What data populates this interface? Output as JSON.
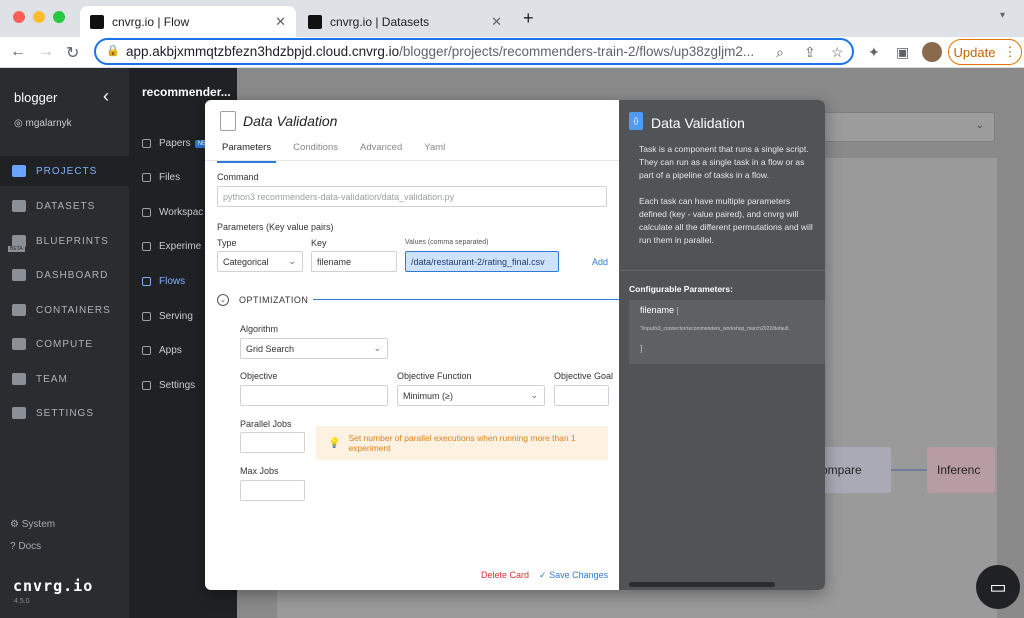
{
  "browser": {
    "tabs": [
      {
        "title": "cnvrg.io | Flow",
        "close": "✕"
      },
      {
        "title": "cnvrg.io | Datasets",
        "close": "✕"
      }
    ],
    "new_tab": "+",
    "url_host": "app.akbjxmmqtzbfezn3hdzbpjd.cloud.cnvrg.io",
    "url_path": "/blogger/projects/recommenders-train-2/flows/up38zgljm2...",
    "update_label": "Update",
    "menu": "⋮"
  },
  "sidebar": {
    "org": "blogger",
    "user": "mgalarnyk",
    "items": [
      "PROJECTS",
      "DATASETS",
      "BLUEPRINTS",
      "DASHBOARD",
      "CONTAINERS",
      "COMPUTE",
      "TEAM",
      "SETTINGS"
    ],
    "beta": "BETA",
    "footer": [
      "System",
      "Docs"
    ],
    "logo": "cnvrg.io",
    "version": "4.5.0"
  },
  "project_nav": {
    "title": "recommender...",
    "items": [
      "Papers",
      "Files",
      "Workspac",
      "Experime",
      "Flows",
      "Serving",
      "Apps",
      "Settings"
    ],
    "new_badge": "NE"
  },
  "canvas": {
    "nodes": [
      "ompare",
      "Inferenc"
    ]
  },
  "modal": {
    "title": "Data Validation",
    "tabs": [
      "Parameters",
      "Conditions",
      "Advanced",
      "Yaml"
    ],
    "command_label": "Command",
    "command_value": "python3 recommenders-data-validation/data_validation.py",
    "params_label": "Parameters (Key value pairs)",
    "type_label": "Type",
    "key_label": "Key",
    "values_label": "Values (comma separated)",
    "type_value": "Categorical",
    "key_value": "filename",
    "values_value": "/data/restaurant-2/rating_final.csv",
    "add_label": "Add",
    "optimization_label": "OPTIMIZATION",
    "algorithm_label": "Algorithm",
    "algorithm_value": "Grid Search",
    "objective_label": "Objective",
    "objective_function_label": "Objective Function",
    "objective_function_value": "Minimum (≥)",
    "objective_goal_label": "Objective Goal",
    "parallel_jobs_label": "Parallel Jobs",
    "hint_text": "Set number of parallel executions when running more than 1 experiment",
    "max_jobs_label": "Max Jobs",
    "delete_label": "Delete Card",
    "save_label": "Save Changes"
  },
  "info_panel": {
    "title": "Data Validation",
    "desc_1": "Task is a component that runs a single script. They can run as a single task in a flow or as part of a pipeline of tasks in a flow.",
    "desc_2": "Each task can have multiple parameters defined (key - value paired), and cnvrg will calculate all the different permutations and will run them in parallel.",
    "config_label": "Configurable Parameters:",
    "param_name": "filename",
    "param_value": "\"/input/s3_connector/recommenders_workshop_march2022/default.",
    "close_brace": "]"
  }
}
